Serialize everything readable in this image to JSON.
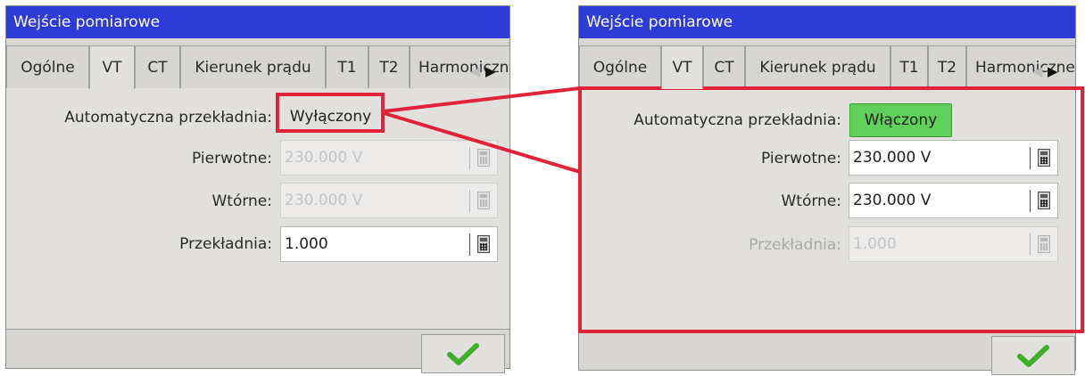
{
  "left_panel": {
    "title": "Wejście pomiarowe",
    "tabs": [
      {
        "label": "Ogólne"
      },
      {
        "label": "VT",
        "selected": true
      },
      {
        "label": "CT"
      },
      {
        "label": "Kierunek prądu"
      },
      {
        "label": "T1"
      },
      {
        "label": "T2"
      },
      {
        "label": "Harmoniczne"
      }
    ],
    "auto_label": "Automatyczna przekładnia:",
    "auto_value": "Wyłączony",
    "primary_label": "Pierwotne:",
    "primary_value": "230.000 V",
    "secondary_label": "Wtórne:",
    "secondary_value": "230.000 V",
    "ratio_label": "Przekładnia:",
    "ratio_value": "1.000"
  },
  "right_panel": {
    "title": "Wejście pomiarowe",
    "tabs": [
      {
        "label": "Ogólne"
      },
      {
        "label": "VT",
        "selected": true
      },
      {
        "label": "CT"
      },
      {
        "label": "Kierunek prądu"
      },
      {
        "label": "T1"
      },
      {
        "label": "T2"
      },
      {
        "label": "Harmoniczne"
      }
    ],
    "auto_label": "Automatyczna przekładnia:",
    "auto_value": "Włączony",
    "primary_label": "Pierwotne:",
    "primary_value": "230.000 V",
    "secondary_label": "Wtórne:",
    "secondary_value": "230.000 V",
    "ratio_label": "Przekładnia:",
    "ratio_value": "1.000"
  },
  "colors": {
    "titlebar": "#2f3bd6",
    "toggle_on": "#5fd15a",
    "callout": "#e0233a",
    "checkmark": "#3fae2b"
  },
  "icons": [
    "calculator-icon",
    "checkmark-icon",
    "scroll-left-icon",
    "scroll-right-icon"
  ]
}
